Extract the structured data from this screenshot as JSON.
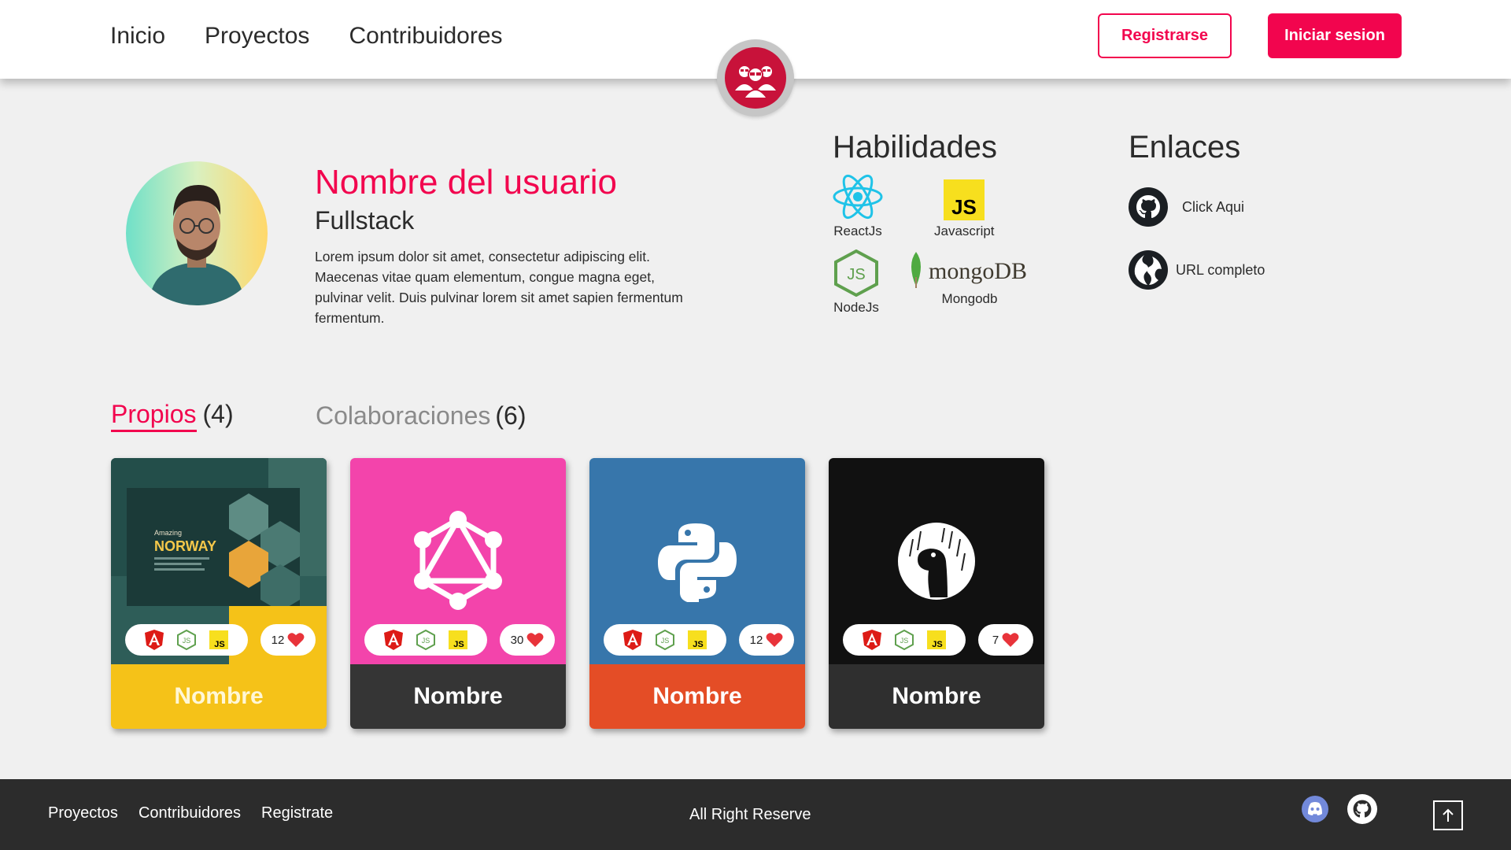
{
  "header": {
    "nav": [
      "Inicio",
      "Proyectos",
      "Contribuidores"
    ],
    "register_label": "Registrarse",
    "login_label": "Iniciar sesion",
    "accent_color": "#f2054e"
  },
  "profile": {
    "name": "Nombre del usuario",
    "role": "Fullstack",
    "bio": "Lorem ipsum dolor sit amet, consectetur adipiscing elit. Maecenas vitae quam elementum, congue magna eget, pulvinar velit. Duis  pulvinar lorem sit amet sapien fermentum fermentum."
  },
  "skills": {
    "title": "Habilidades",
    "items": [
      {
        "label": "ReactJs",
        "icon": "react-icon"
      },
      {
        "label": "Javascript",
        "icon": "javascript-icon"
      },
      {
        "label": "NodeJs",
        "icon": "nodejs-icon"
      },
      {
        "label": "Mongodb",
        "icon": "mongodb-icon",
        "logo_text": "mongoDB"
      }
    ]
  },
  "links": {
    "title": "Enlaces",
    "items": [
      {
        "label": "Click Aqui",
        "icon": "github-icon"
      },
      {
        "label": "URL completo",
        "icon": "globe-icon"
      }
    ]
  },
  "tabs": {
    "own": {
      "label": "Propios",
      "count": "(4)"
    },
    "collab": {
      "label": "Colaboraciones",
      "count": "(6)"
    }
  },
  "preview": {
    "title_small": "Amazing",
    "title_big": "NORWAY"
  },
  "projects": [
    {
      "name": "Nombre",
      "likes": "12",
      "icon": "website-preview",
      "top_color": "#1f4a47",
      "bottom_color": "#f5c218",
      "name_color": "#fff7d6"
    },
    {
      "name": "Nombre",
      "likes": "30",
      "icon": "graphql-icon",
      "top_color": "#f344ab",
      "bottom_color": "#353535",
      "name_color": "#ffffff"
    },
    {
      "name": "Nombre",
      "likes": "12",
      "icon": "python-icon",
      "top_color": "#3776ab",
      "bottom_color": "#e44d26",
      "name_color": "#ffffff"
    },
    {
      "name": "Nombre",
      "likes": "7",
      "icon": "deno-icon",
      "top_color": "#111111",
      "bottom_color": "#2f2f2f",
      "name_color": "#ffffff"
    }
  ],
  "footer": {
    "links": [
      "Proyectos",
      "Contribuidores",
      "Registrate"
    ],
    "copyright": "All Right Reserve"
  }
}
